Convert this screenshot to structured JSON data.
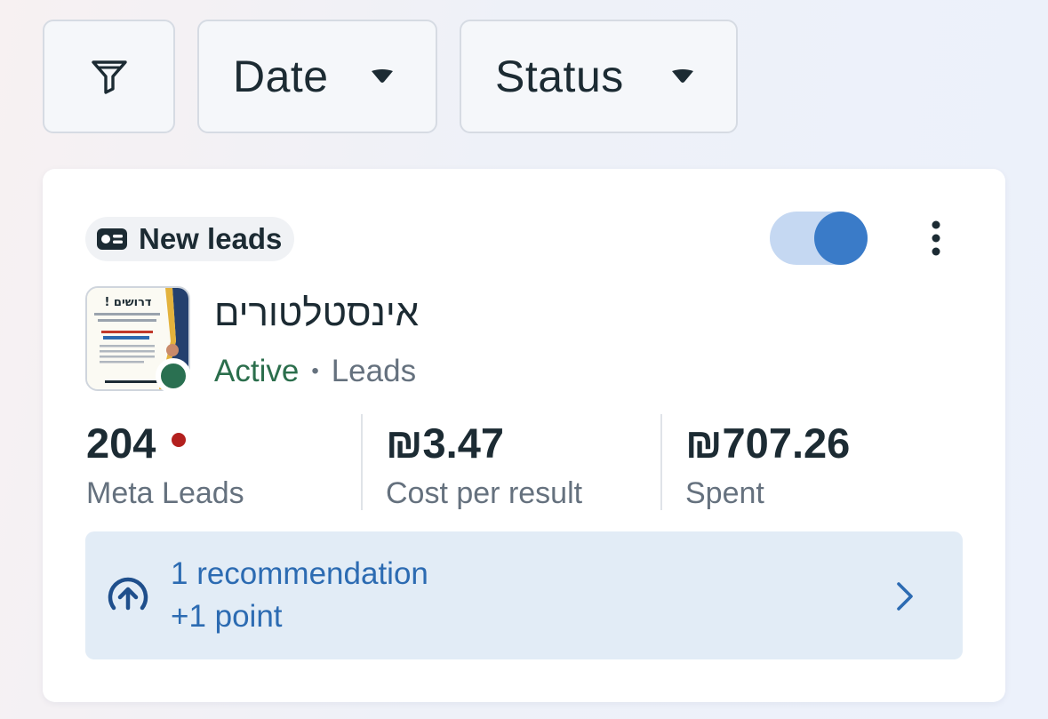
{
  "filters": {
    "filter_icon": "filter-funnel-icon",
    "date_label": "Date",
    "status_label": "Status"
  },
  "ad_card": {
    "objective_label": "New leads",
    "objective_icon": "lead-form-icon",
    "toggle_on": true,
    "ad_name": "אינסטלטורים",
    "status": "Active",
    "separator": "•",
    "ad_type": "Leads",
    "metrics": [
      {
        "value": "204",
        "label": "Meta Leads",
        "has_alert_dot": true
      },
      {
        "value": "₪3.47",
        "label": "Cost per result"
      },
      {
        "value": "₪707.26",
        "label": "Spent"
      }
    ],
    "recommendation": {
      "title": "1 recommendation",
      "subtitle": "+1 point"
    }
  },
  "colors": {
    "accent": "#3a7bc8",
    "active_green": "#2b6e4c",
    "alert_red": "#b3201e",
    "rec_bg": "#e2ecf6",
    "rec_text": "#2c6bb2"
  },
  "thumbnail": {
    "header_text": "דרושים !"
  }
}
